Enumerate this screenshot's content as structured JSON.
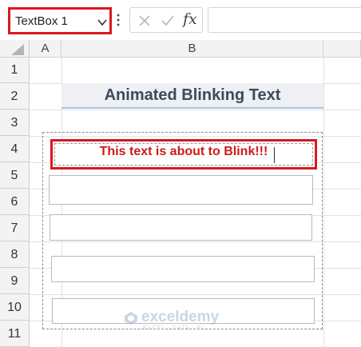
{
  "formula_bar": {
    "name_box_value": "TextBox 1",
    "fx_label": "fx",
    "formula_value": ""
  },
  "columns": [
    "A",
    "B"
  ],
  "rows": [
    "1",
    "2",
    "3",
    "4",
    "5",
    "6",
    "7",
    "8",
    "9",
    "10",
    "11"
  ],
  "title_cell": "Animated Blinking Text",
  "textbox_1": "This text is about to Blink!!!",
  "watermark": {
    "name": "exceldemy",
    "tagline": "EXCEL · DATA · BI"
  },
  "colors": {
    "highlight_red": "#d9191c",
    "text_red": "#cc1a1a",
    "title_text": "#3d4a5c",
    "title_underline": "#a4c3e3"
  },
  "icons": [
    "chevron-down-icon",
    "cancel-icon",
    "enter-icon",
    "fx-icon",
    "select-all-icon"
  ]
}
